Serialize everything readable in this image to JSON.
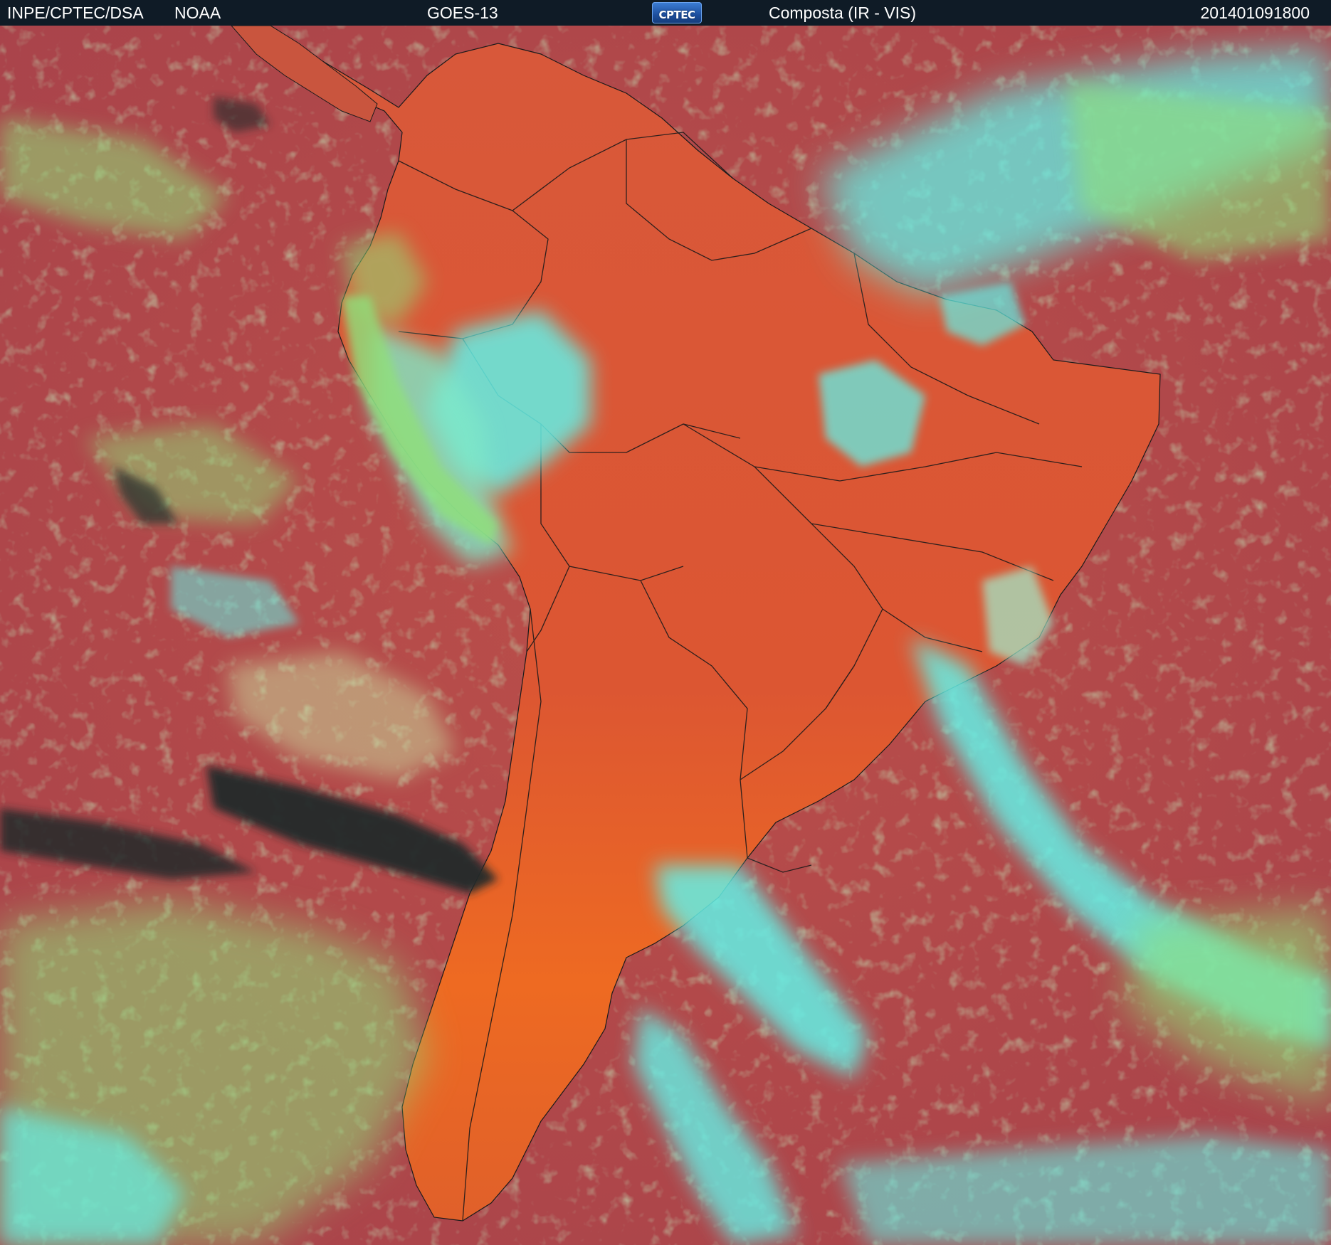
{
  "header": {
    "source": "INPE/CPTEC/DSA",
    "agency": "NOAA",
    "satellite": "GOES-13",
    "logo_text": "CPTEC",
    "product": "Composta (IR - VIS)",
    "timestamp": "201401091800"
  },
  "colors": {
    "header_bg": "#0f1b26",
    "ocean": "#b54a48",
    "land": "#e2582e",
    "cloud_low": "#8fe07a",
    "cloud_high": "#63f0e6",
    "cold_top": "#232a2c",
    "border_lines": "#1a1a1a"
  },
  "map": {
    "region": "South America",
    "layers": [
      "ocean",
      "continent",
      "political-borders",
      "cloud-bands"
    ]
  }
}
